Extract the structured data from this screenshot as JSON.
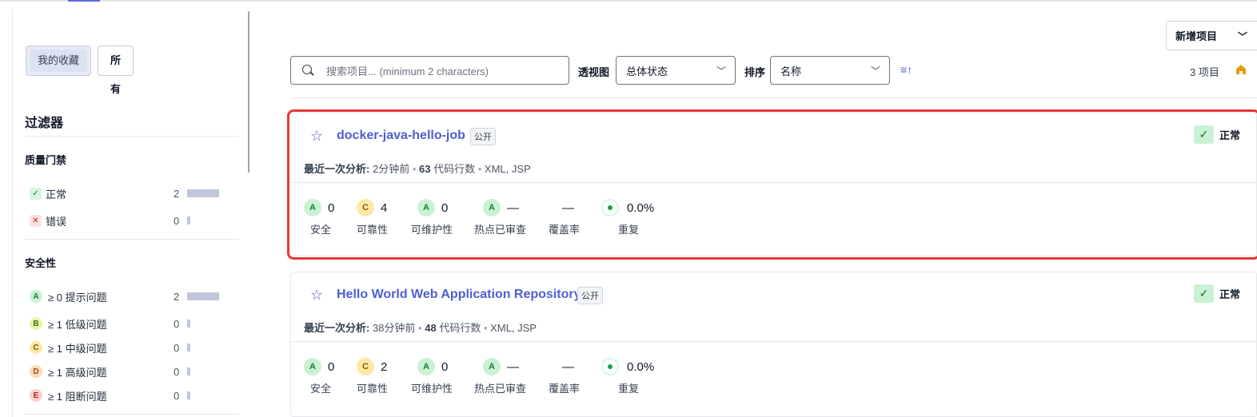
{
  "colors": {
    "accent": "#4f5fd1",
    "highlight": "#e53935",
    "ok": "#166534"
  },
  "sidebar": {
    "seg_favorites": "我的收藏",
    "seg_all": "所有",
    "title": "过滤器",
    "quality_gate": {
      "title": "质量门禁",
      "items": [
        {
          "label": "正常",
          "count": "2",
          "icon": "check-icon"
        },
        {
          "label": "错误",
          "count": "0",
          "icon": "x-icon"
        }
      ]
    },
    "security": {
      "title": "安全性",
      "items": [
        {
          "grade": "A",
          "label": "≥ 0 提示问题",
          "count": "2"
        },
        {
          "grade": "B",
          "label": "≥ 1 低级问题",
          "count": "0"
        },
        {
          "grade": "C",
          "label": "≥ 1 中级问题",
          "count": "0"
        },
        {
          "grade": "D",
          "label": "≥ 1 高级问题",
          "count": "0"
        },
        {
          "grade": "E",
          "label": "≥ 1 阻断问题",
          "count": "0"
        }
      ]
    }
  },
  "toolbar": {
    "new_project": "新增项目",
    "search_placeholder": "搜索项目... (minimum 2 characters)",
    "perspective_label": "透视图",
    "perspective_value": "总体状态",
    "sort_label": "排序",
    "sort_value": "名称",
    "count": "3 项目"
  },
  "projects": [
    {
      "name": "docker-java-hello-job",
      "visibility": "公开",
      "status": "正常",
      "meta_label": "最近一次分析:",
      "meta_time": "2分钟前",
      "loc": "63",
      "loc_label": "代码行数",
      "langs": "XML, JSP",
      "metrics": [
        {
          "grade": "A",
          "value": "0",
          "caption": "安全"
        },
        {
          "grade": "C",
          "value": "4",
          "caption": "可靠性"
        },
        {
          "grade": "A",
          "value": "0",
          "caption": "可维护性"
        },
        {
          "grade": "A",
          "value": "—",
          "caption": "热点已审查"
        },
        {
          "grade": "",
          "value": "—",
          "caption": "覆盖率"
        },
        {
          "grade": "",
          "value": "0.0%",
          "caption": "重复"
        }
      ]
    },
    {
      "name": "Hello World Web Application Repository",
      "visibility": "公开",
      "status": "正常",
      "meta_label": "最近一次分析:",
      "meta_time": "38分钟前",
      "loc": "48",
      "loc_label": "代码行数",
      "langs": "XML, JSP",
      "metrics": [
        {
          "grade": "A",
          "value": "0",
          "caption": "安全"
        },
        {
          "grade": "C",
          "value": "2",
          "caption": "可靠性"
        },
        {
          "grade": "A",
          "value": "0",
          "caption": "可维护性"
        },
        {
          "grade": "A",
          "value": "—",
          "caption": "热点已审查"
        },
        {
          "grade": "",
          "value": "—",
          "caption": "覆盖率"
        },
        {
          "grade": "",
          "value": "0.0%",
          "caption": "重复"
        }
      ]
    }
  ]
}
